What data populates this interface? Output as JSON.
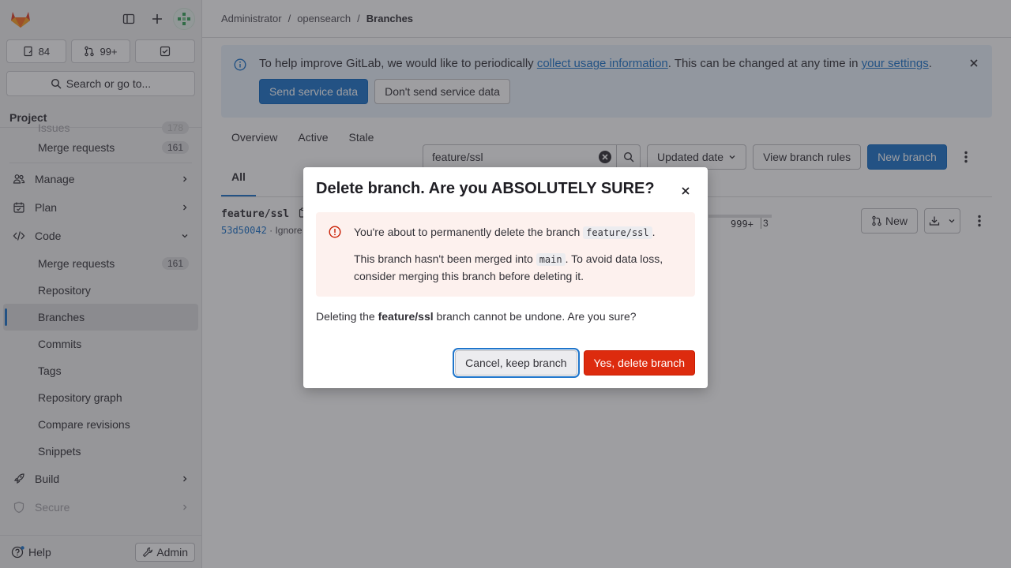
{
  "sidebar": {
    "counts": {
      "issues": "84",
      "merge_requests": "99+"
    },
    "search_label": "Search or go to...",
    "section_title": "Project",
    "items": [
      {
        "label": "Issues",
        "badge": "178"
      },
      {
        "label": "Merge requests",
        "badge": "161"
      },
      {
        "label": "Manage"
      },
      {
        "label": "Plan"
      },
      {
        "label": "Code"
      },
      {
        "label": "Merge requests",
        "badge": "161"
      },
      {
        "label": "Repository"
      },
      {
        "label": "Branches"
      },
      {
        "label": "Commits"
      },
      {
        "label": "Tags"
      },
      {
        "label": "Repository graph"
      },
      {
        "label": "Compare revisions"
      },
      {
        "label": "Snippets"
      },
      {
        "label": "Build"
      },
      {
        "label": "Secure"
      }
    ],
    "help_label": "Help",
    "admin_label": "Admin"
  },
  "breadcrumb": {
    "level1": "Administrator",
    "level2": "opensearch",
    "current": "Branches",
    "sep": "/"
  },
  "banner": {
    "text_before": "To help improve GitLab, we would like to periodically ",
    "link1": "collect usage information",
    "text_mid": ". This can be changed at any time in ",
    "link2": "your settings",
    "text_after": ".",
    "send_btn": "Send service data",
    "dont_send_btn": "Don't send service data"
  },
  "tabs": {
    "overview": "Overview",
    "active": "Active",
    "stale": "Stale",
    "all": "All"
  },
  "toolbar": {
    "filter_value": "feature/ssl",
    "sort_label": "Updated date",
    "rules_label": "View branch rules",
    "new_branch_label": "New branch"
  },
  "branch_row": {
    "name": "feature/ssl",
    "sha": "53d50042",
    "meta_sep": " · ",
    "meta_text": "Ignore",
    "behind": "999+",
    "ahead": "3",
    "new_mr_label": "New"
  },
  "modal": {
    "title": "Delete branch. Are you ABSOLUTELY SURE?",
    "alert_line1_before": "You're about to permanently delete the branch ",
    "alert_branch": "feature/ssl",
    "alert_line1_after": ".",
    "alert_line2_before": "This branch hasn't been merged into ",
    "alert_target": "main",
    "alert_line2_after": ". To avoid data loss, consider merging this branch before deleting it.",
    "body_before": "Deleting the ",
    "body_branch": "feature/ssl",
    "body_after": " branch cannot be undone. Are you sure?",
    "cancel_label": "Cancel, keep branch",
    "confirm_label": "Yes, delete branch"
  },
  "colors": {
    "primary": "#1f75cb",
    "danger": "#dd2b0e",
    "alert_bg": "#fdf1ee",
    "banner_bg": "#e9f3fc"
  }
}
